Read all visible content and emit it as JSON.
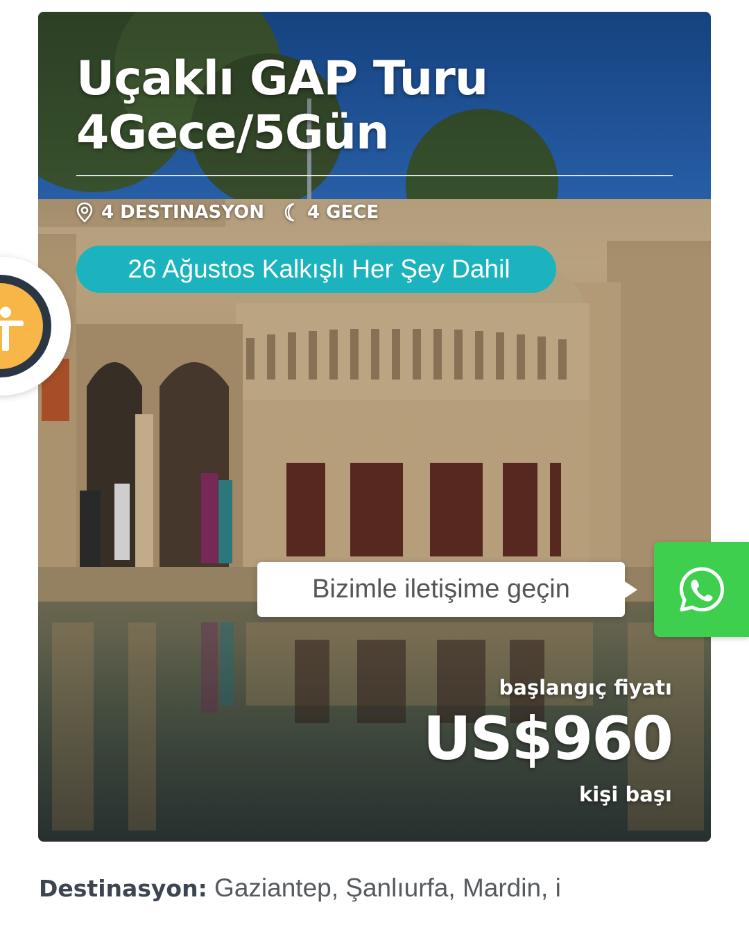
{
  "tour": {
    "title_line1": "Uçaklı GAP Turu",
    "title_line2": "4Gece/5Gün",
    "destinations_count": "4 DESTINASYON",
    "nights": "4 GECE",
    "badge": "26 Ağustos Kalkışlı Her Şey Dahil",
    "price_label": "başlangıç fiyatı",
    "price": "US$960",
    "price_unit": "kişi başı"
  },
  "details": {
    "destination_label": "Destinasyon:",
    "destination_value": " Gaziantep, Şanlıurfa, Mardin, i"
  },
  "contact": {
    "tooltip": "Bizimle iletişime geçin",
    "icon": "whatsapp-icon"
  },
  "accessibility": {
    "icon": "accessibility-icon"
  },
  "colors": {
    "badge": "#1bb3bd",
    "whatsapp": "#3ecf4f",
    "accessibility_ring": "#2a3644",
    "accessibility_core": "#f8b548",
    "sky": "#2f6fc0",
    "stone": "#b59d79"
  }
}
